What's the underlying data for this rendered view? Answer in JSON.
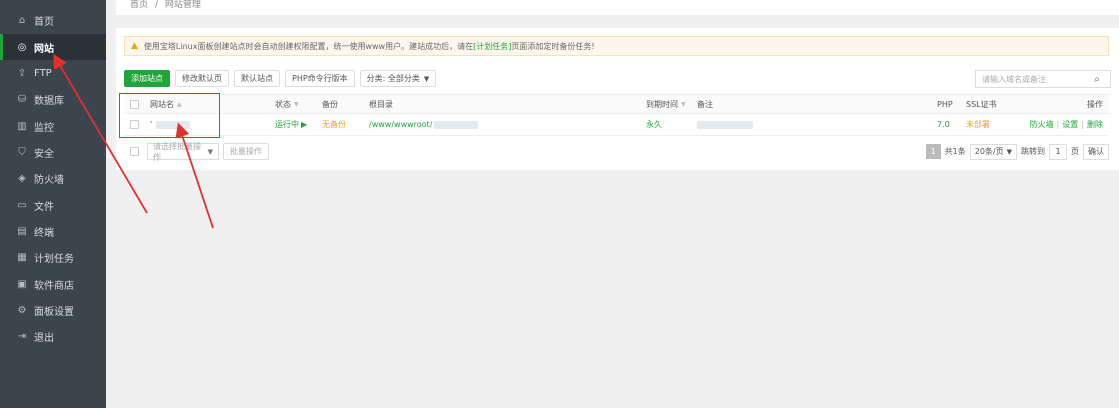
{
  "sidebar": {
    "items": [
      {
        "label": "首页",
        "icon": "home-icon",
        "glyph": "⌂",
        "active": false
      },
      {
        "label": "网站",
        "icon": "globe-icon",
        "glyph": "◎",
        "active": true
      },
      {
        "label": "FTP",
        "icon": "ftp-icon",
        "glyph": "⇪",
        "active": false
      },
      {
        "label": "数据库",
        "icon": "database-icon",
        "glyph": "⛁",
        "active": false
      },
      {
        "label": "监控",
        "icon": "monitor-icon",
        "glyph": "▥",
        "active": false
      },
      {
        "label": "安全",
        "icon": "shield-icon",
        "glyph": "⛉",
        "active": false
      },
      {
        "label": "防火墙",
        "icon": "firewall-icon",
        "glyph": "◈",
        "active": false
      },
      {
        "label": "文件",
        "icon": "folder-icon",
        "glyph": "▭",
        "active": false
      },
      {
        "label": "终端",
        "icon": "terminal-icon",
        "glyph": "▤",
        "active": false
      },
      {
        "label": "计划任务",
        "icon": "schedule-icon",
        "glyph": "▦",
        "active": false
      },
      {
        "label": "软件商店",
        "icon": "grid-icon",
        "glyph": "▣",
        "active": false
      },
      {
        "label": "面板设置",
        "icon": "gear-icon",
        "glyph": "⚙",
        "active": false
      },
      {
        "label": "退出",
        "icon": "logout-icon",
        "glyph": "⇥",
        "active": false
      }
    ]
  },
  "breadcrumb": {
    "home": "首页",
    "separator": "/",
    "current": "网站管理"
  },
  "notice": {
    "text_before": "使用宝塔Linux面板创建站点时会自动创建权限配置，统一使用www用户。建站成功后，请在",
    "link": "[计划任务]",
    "text_after": "页面添加定时备份任务!"
  },
  "toolbar": {
    "add_site": "添加站点",
    "edit_default_page": "修改默认页",
    "default_site": "默认站点",
    "php_cli_version": "PHP命令行版本",
    "category": "分类: 全部分类"
  },
  "search": {
    "placeholder": "请输入域名或备注"
  },
  "table": {
    "headers": {
      "site_name": "网站名",
      "status": "状态",
      "backup": "备份",
      "root_dir": "根目录",
      "expire": "到期时间",
      "remark": "备注",
      "php": "PHP",
      "ssl": "SSL证书",
      "actions": "操作"
    },
    "rows": [
      {
        "site_name": "'",
        "status": "运行中",
        "status_icon": "▶",
        "backup": "无备份",
        "root_dir": "/www/wwwroot/",
        "expire": "永久",
        "php": "7.0",
        "ssl": "未部署",
        "action_firewall": "防火墙",
        "action_settings": "设置",
        "action_delete": "删除",
        "action_sep": "|"
      }
    ]
  },
  "footer": {
    "batch_select": "请选择批量操作",
    "batch_btn": "批量操作",
    "current_page": "1",
    "total": "共1条",
    "per_page": "20条/页",
    "jump_to": "跳转到",
    "jump_value": "1",
    "page_unit": "页",
    "confirm": "确认"
  },
  "colors": {
    "sidebar_bg": "#3c444d",
    "accent_green": "#20a53a",
    "warn_orange": "#f0a020",
    "annotation_red": "#e03030"
  }
}
